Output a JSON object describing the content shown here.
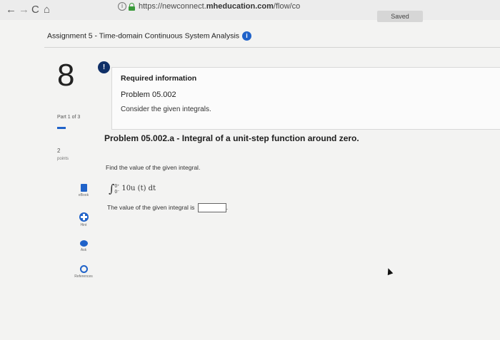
{
  "browser": {
    "back": "←",
    "forward": "→",
    "reload": "C",
    "home": "⌂",
    "url_prefix": "https://newconnect.",
    "url_host": "mheducation.com",
    "url_suffix": "/flow/co",
    "saved_label": "Saved"
  },
  "assignment": {
    "title": "Assignment 5 - Time-domain Continuous System Analysis",
    "info_icon": "i"
  },
  "question": {
    "number": "8",
    "alert_icon": "!",
    "part": "Part 1 of 3",
    "points_value": "2",
    "points_label": "points"
  },
  "info_box": {
    "heading": "Required information",
    "problem": "Problem 05.002",
    "text": "Consider the given integrals."
  },
  "problem": {
    "title": "Problem 05.002.a - Integral of a unit-step function around zero.",
    "instruction": "Find the value of the given integral.",
    "integral_sign": "∫",
    "upper_limit": "0⁺",
    "lower_limit": "0⁻",
    "integrand": "10u (t) dt",
    "answer_prefix": "The value of the given integral is",
    "answer_suffix": ".",
    "answer_value": ""
  },
  "tools": {
    "ebook": "eBook",
    "hint": "Hint",
    "ask": "Ask",
    "references": "References"
  },
  "icons": {
    "ebook": "book-icon",
    "hint": "hint-icon",
    "ask": "chat-bubble-icon",
    "references": "references-icon"
  },
  "colors": {
    "accent": "#1f62c9",
    "alert": "#0f2f67"
  }
}
